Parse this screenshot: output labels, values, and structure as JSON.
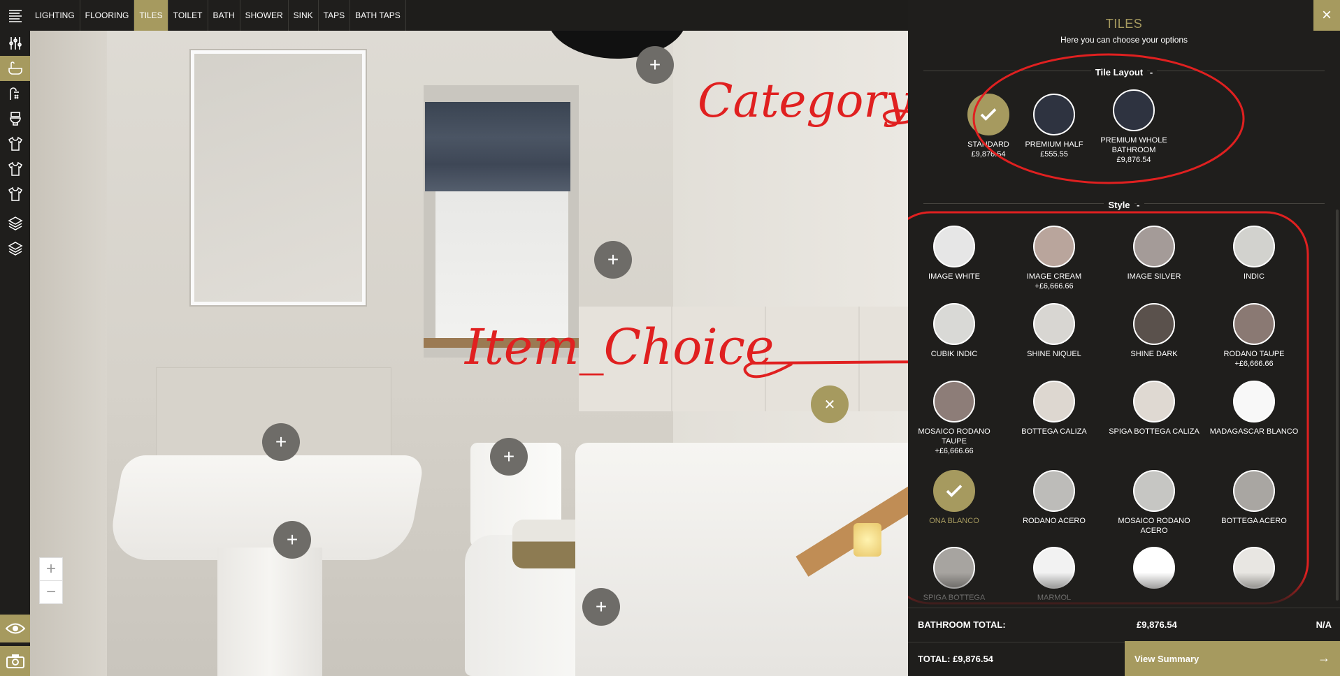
{
  "top_tabs": [
    "LIGHTING",
    "FLOORING",
    "TILES",
    "TOILET",
    "BATH",
    "SHOWER",
    "SINK",
    "TAPS",
    "BATH TAPS"
  ],
  "active_tab": "TILES",
  "rail_icons": [
    "menu-icon",
    "cutlery-icon",
    "bath-icon",
    "shower-icon",
    "toilet-icon",
    "shirt-icon",
    "shirt-icon",
    "shirt-icon",
    "layers-icon",
    "layers-icon"
  ],
  "zoom": {
    "in": "+",
    "out": "−"
  },
  "annotations": {
    "category": "Category",
    "item_choice": "Item_Choice"
  },
  "panel": {
    "title": "TILES",
    "subtitle": "Here you can choose your options",
    "close": "×",
    "tile_layout_heading": "Tile Layout",
    "collapse_symbol": "-",
    "style_heading": "Style",
    "layouts": [
      {
        "label": "STANDARD",
        "price": "£9,876.54",
        "selected": true
      },
      {
        "label": "PREMIUM HALF",
        "price": "£555.55",
        "selected": false
      },
      {
        "label": "PREMIUM WHOLE BATHROOM",
        "price": "£9,876.54",
        "selected": false
      }
    ],
    "styles": [
      {
        "label": "IMAGE WHITE",
        "price": "",
        "color": "#e6e6e6",
        "selected": false
      },
      {
        "label": "IMAGE CREAM",
        "price": "+£6,666.66",
        "color": "#b9a59c",
        "selected": false
      },
      {
        "label": "IMAGE SILVER",
        "price": "",
        "color": "#a49b98",
        "selected": false
      },
      {
        "label": "INDIC",
        "price": "",
        "color": "#d2d2ce",
        "selected": false
      },
      {
        "label": "CUBIK INDIC",
        "price": "",
        "color": "#d9d9d6",
        "selected": false
      },
      {
        "label": "SHINE NIQUEL",
        "price": "",
        "color": "#d8d6d2",
        "selected": false
      },
      {
        "label": "SHINE DARK",
        "price": "",
        "color": "#5a514c",
        "selected": false
      },
      {
        "label": "RODANO TAUPE",
        "price": "+£6,666.66",
        "color": "#8a7973",
        "selected": false
      },
      {
        "label": "MOSAICO RODANO TAUPE",
        "price": "+£6,666.66",
        "color": "#8d7d78",
        "selected": false
      },
      {
        "label": "BOTTEGA CALIZA",
        "price": "",
        "color": "#ddd7d0",
        "selected": false
      },
      {
        "label": "SPIGA BOTTEGA CALIZA",
        "price": "",
        "color": "#dfd9d2",
        "selected": false
      },
      {
        "label": "MADAGASCAR BLANCO",
        "price": "",
        "color": "#f8f8f8",
        "selected": false
      },
      {
        "label": "ONA BLANCO",
        "price": "",
        "color": "#a69a5f",
        "selected": true
      },
      {
        "label": "RODANO ACERO",
        "price": "",
        "color": "#bdbcb9",
        "selected": false
      },
      {
        "label": "MOSAICO RODANO ACERO",
        "price": "",
        "color": "#c6c6c3",
        "selected": false
      },
      {
        "label": "BOTTEGA ACERO",
        "price": "",
        "color": "#a9a6a2",
        "selected": false
      },
      {
        "label": "SPIGA BOTTEGA",
        "price": "",
        "color": "#a7a4a0",
        "selected": false
      },
      {
        "label": "MARMOL",
        "price": "",
        "color": "#f2f2f2",
        "selected": false
      },
      {
        "label": "",
        "price": "",
        "color": "#ffffff",
        "selected": false
      },
      {
        "label": "",
        "price": "",
        "color": "#e8e6e2",
        "selected": false
      }
    ],
    "bathroom_total_label": "BATHROOM TOTAL:",
    "bathroom_total_value": "£9,876.54",
    "na": "N/A",
    "total": "TOTAL: £9,876.54",
    "view_summary": "View Summary",
    "arrow": "→"
  }
}
